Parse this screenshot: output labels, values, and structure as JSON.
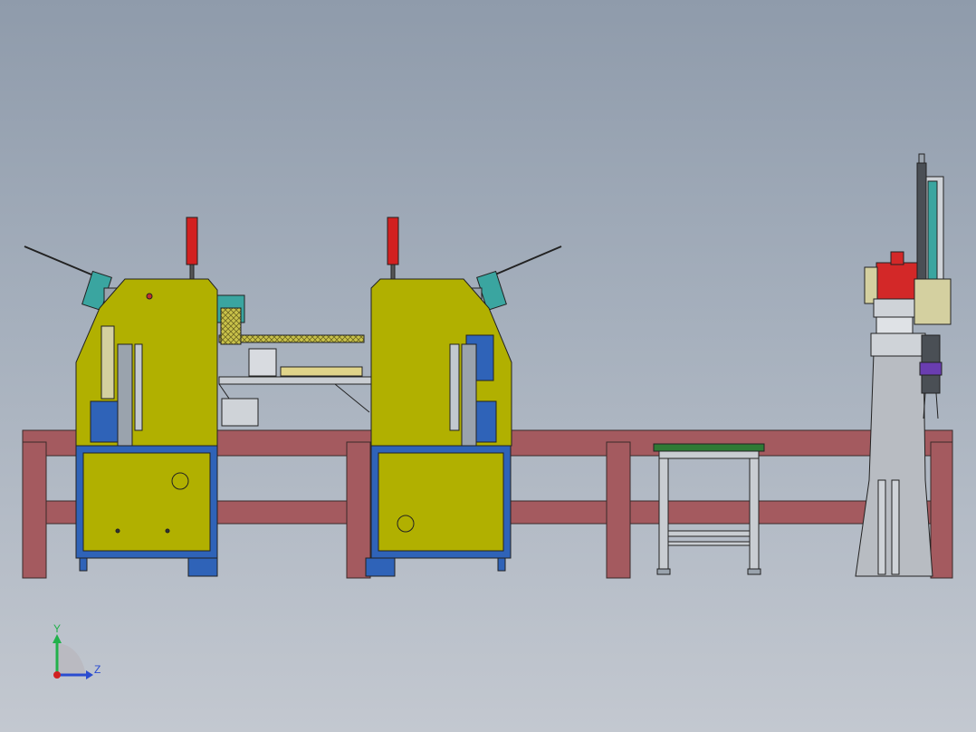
{
  "scene": {
    "colors": {
      "background_top": "#8f9bab",
      "background_bottom": "#c3c8d0",
      "rail": "#a45a5f",
      "machine_body": "#b1b000",
      "machine_base": "#2f63b8",
      "signal_light": "#d22020",
      "robot_column": "#b8bcc2",
      "robot_head": "#d32828",
      "table_top": "#2f7a35",
      "teal_part": "#3aa5a0"
    },
    "components": [
      "machine-left",
      "machine-right",
      "conveyor-bridge",
      "work-table",
      "robot-column",
      "guard-rail"
    ]
  },
  "triad": {
    "y_label": "Y",
    "z_label": "Z",
    "y_color": "#22b14c",
    "z_color": "#2a4cd0",
    "x_color": "#d02020"
  }
}
